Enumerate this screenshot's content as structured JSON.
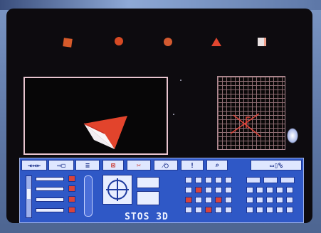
{
  "program": {
    "title": "STOS 3D"
  },
  "toolbar": {
    "tools": [
      {
        "label": "⇥↔⇤",
        "icon": "scale-icon"
      },
      {
        "label": "⇨◻",
        "icon": "move-icon"
      },
      {
        "label": "≡",
        "icon": "list-icon"
      },
      {
        "label": "⊠",
        "icon": "delete-icon"
      },
      {
        "label": "✂",
        "icon": "cut-icon"
      },
      {
        "label": "⁄○",
        "icon": "draw-icon"
      },
      {
        "label": "!",
        "icon": "alert-icon"
      },
      {
        "label": "⌕",
        "icon": "zoom-icon"
      },
      {
        "label": "▭▯%",
        "icon": "file-icon"
      }
    ]
  },
  "palette": [
    {
      "icon": "cube-orange-icon",
      "color": "#d65a2a"
    },
    {
      "icon": "sphere-orange-icon",
      "color": "#d64a24"
    },
    {
      "icon": "sphere-orange-icon",
      "color": "#d35a30"
    },
    {
      "icon": "cone-red-icon",
      "color": "#e2462f"
    },
    {
      "icon": "cube-white-icon",
      "color": "#e9e1e2"
    }
  ],
  "colors": {
    "object_red": "#e2442c",
    "object_white": "#f2eef2",
    "grid_line": "#8f6d73",
    "panel_blue": "#2f58c6"
  }
}
